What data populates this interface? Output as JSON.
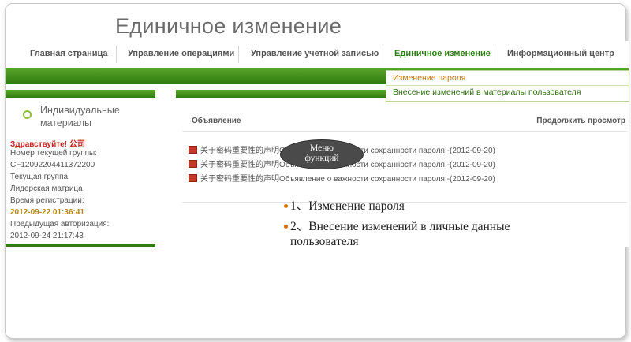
{
  "slide": {
    "title": "Единичное изменение"
  },
  "nav": {
    "items": [
      {
        "label": "Главная страница"
      },
      {
        "label": "Управление операциями"
      },
      {
        "label": "Управление учетной записью"
      },
      {
        "label": "Единичное изменение"
      },
      {
        "label": "Информационный центр"
      }
    ]
  },
  "dropdown": {
    "items": [
      {
        "label": "Изменение пароля"
      },
      {
        "label": "Внесение изменений в материалы пользователя"
      }
    ]
  },
  "sidebar": {
    "title": "Индивидуальные материалы",
    "greeting": "Здравствуйте! 公司",
    "group_label": "Номер текущей группы:",
    "group_value": "CF12092204411372200",
    "current_group_label": "Текущая группа:",
    "current_group_value": "Лидерская матрица",
    "reg_time_label": "Время регистрации:",
    "reg_time_value": "2012-09-22 01:36:41",
    "prev_auth_label": "Предыдущая авторизация:",
    "prev_auth_value": "2012-09-24 21:17:43"
  },
  "main": {
    "header_title": "Объявление",
    "header_more": "Продолжить просмотр",
    "announcements": [
      {
        "text": "关于密码重要性的声明Объявление о важности сохранности пароля!-(2012-09-20)"
      },
      {
        "text": "关于密码重要性的声明Объявление о важности сохранности пароля!-(2012-09-20)"
      },
      {
        "text": "关于密码重要性的声明Объявление о важности сохранности пароля!-(2012-09-20)"
      }
    ]
  },
  "bubble": {
    "line1": "Меню",
    "line2": "функций"
  },
  "bullets": [
    {
      "text": "1、Изменение пароля"
    },
    {
      "text": "2、Внесение изменений в личные данные пользователя"
    }
  ],
  "colors": {
    "accent_green": "#2f7d10",
    "dropdown_highlight": "#c87a10",
    "greeting_red": "#cc1f1f",
    "bullet_dot": "#e06a00"
  }
}
